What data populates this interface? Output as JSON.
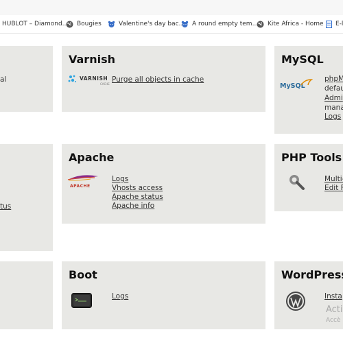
{
  "bookmarks": [
    {
      "label": "HUBLOT – Diamond...",
      "icon": "hublot-icon"
    },
    {
      "label": "Bougies",
      "icon": "globe-icon"
    },
    {
      "label": "Valentine's day bac...",
      "icon": "bear-icon"
    },
    {
      "label": "A round empty tem...",
      "icon": "bear-icon"
    },
    {
      "label": "Kite Africa - Home",
      "icon": "globe-icon"
    },
    {
      "label": "E-l",
      "icon": "page-icon"
    }
  ],
  "left_panels": {
    "row1_text": "al",
    "row2_link": "tus"
  },
  "varnish": {
    "title": "Varnish",
    "logo_text": "VARNISH",
    "logo_sub": "CACHE",
    "links": [
      "Purge all objects in cache"
    ]
  },
  "mysql": {
    "title": "MySQL",
    "logo_text": "MySQL",
    "lines": [
      {
        "text": "phpM",
        "link": true
      },
      {
        "text": "defau",
        "link": false
      },
      {
        "text": "Admi",
        "link": true
      },
      {
        "text": "mana",
        "link": false
      },
      {
        "text": "Logs",
        "link": true
      }
    ]
  },
  "apache": {
    "title": "Apache",
    "logo_text": "APACHE",
    "links": [
      "Logs",
      "Vhosts access",
      "Apache status",
      "Apache info"
    ]
  },
  "phptools": {
    "title": "PHP Tools",
    "links": [
      "Multi-",
      "Edit F"
    ]
  },
  "boot": {
    "title": "Boot",
    "links": [
      "Logs"
    ]
  },
  "wordpress": {
    "title": "WordPress",
    "links": [
      "Insta"
    ],
    "grey_text": "Acti",
    "grey_small": "Accè"
  }
}
